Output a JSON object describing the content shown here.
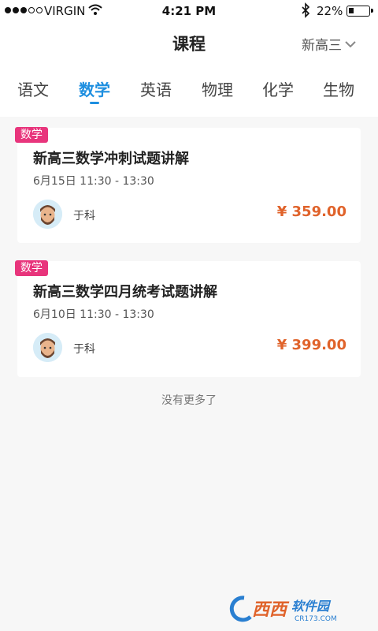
{
  "status_bar": {
    "carrier": "VIRGIN",
    "time": "4:21 PM",
    "battery": "22%",
    "icons": [
      "signal-dots-icon",
      "wifi-icon",
      "bluetooth-icon",
      "battery-icon"
    ]
  },
  "nav": {
    "title": "课程",
    "grade_selector": "新高三"
  },
  "tabs": [
    {
      "label": "语文",
      "active": false
    },
    {
      "label": "数学",
      "active": true
    },
    {
      "label": "英语",
      "active": false
    },
    {
      "label": "物理",
      "active": false
    },
    {
      "label": "化学",
      "active": false
    },
    {
      "label": "生物",
      "active": false
    }
  ],
  "courses": [
    {
      "subject_tag": "数学",
      "title": "新高三数学冲刺试题讲解",
      "time": "6月15日 11:30 - 13:30",
      "teacher": "于科",
      "price": "¥ 359.00"
    },
    {
      "subject_tag": "数学",
      "title": "新高三数学四月统考试题讲解",
      "time": "6月10日 11:30 - 13:30",
      "teacher": "于科",
      "price": "¥ 399.00"
    }
  ],
  "list_end_text": "没有更多了",
  "watermark": "西西软件园",
  "colors": {
    "accent": "#1e8fe0",
    "tag": "#e8357c",
    "price": "#e0632b",
    "background": "#f7f7f7"
  }
}
